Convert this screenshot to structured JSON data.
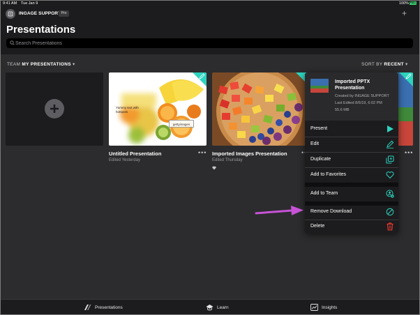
{
  "status": {
    "time": "9:41 AM",
    "date": "Tue Jan 9",
    "battery_pct": "100%",
    "battery_icon_text": "FULL"
  },
  "header": {
    "org_name": "INGAGE SUPPORT",
    "plan_badge": "Pro",
    "title": "Presentations"
  },
  "search": {
    "placeholder": "Search Presentations"
  },
  "filter": {
    "team_prefix": "TEAM",
    "team_value": "MY PRESENTATIONS",
    "sort_prefix": "SORT BY",
    "sort_value": "RECENT"
  },
  "tiles": [
    {
      "title": "Untitled Presentation",
      "subtitle": "Edited Yesterday",
      "thumb_text": "Yummy text with hotspots",
      "watermark": "gettyimages"
    },
    {
      "title": "Imported Images Presentation",
      "subtitle": "Edited Thursday",
      "favorited": true
    }
  ],
  "menu": {
    "title": "Imported PPTX Presentation",
    "created_by": "Created by INGAGE SUPPORT",
    "last_edited": "Last Edited 8/6/19, 6:02 PM",
    "size": "55.6 MB",
    "items": [
      {
        "label": "Present",
        "icon": "play-icon"
      },
      {
        "label": "Edit",
        "icon": "pencil-icon"
      },
      {
        "label": "Duplicate",
        "icon": "duplicate-icon"
      },
      {
        "label": "Add to Favorites",
        "icon": "heart-icon"
      },
      {
        "label": "Add to Team",
        "icon": "team-add-icon"
      },
      {
        "label": "Remove Download",
        "icon": "no-download-icon"
      },
      {
        "label": "Delete",
        "icon": "trash-icon"
      }
    ]
  },
  "tabs": [
    {
      "label": "Presentations",
      "icon": "presentations-icon"
    },
    {
      "label": "Learn",
      "icon": "learn-icon"
    },
    {
      "label": "Insights",
      "icon": "insights-icon"
    }
  ],
  "colors": {
    "accent": "#2dd4bf",
    "delete": "#ff3b30",
    "annotation_arrow": "#c653d6"
  }
}
